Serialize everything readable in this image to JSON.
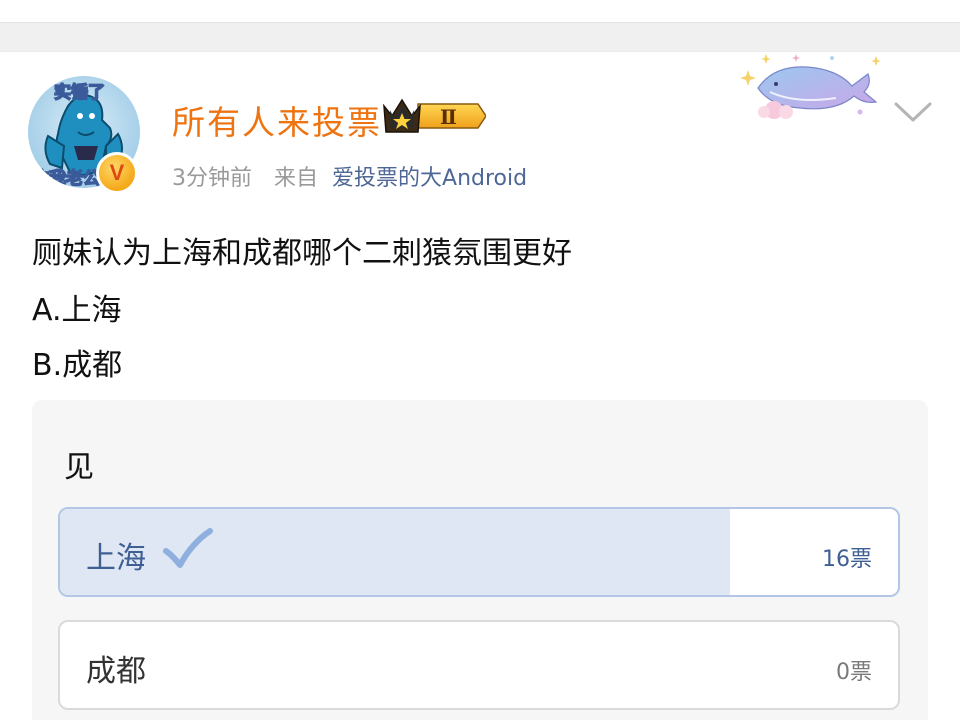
{
  "post": {
    "avatar": {
      "top_text": "实锤了",
      "bottom_text": "这我老公",
      "badge": "V"
    },
    "username": "所有人来投票",
    "level_badge": "Ⅱ",
    "time_ago": "3分钟前",
    "from_label": "来自",
    "source": "爱投票的大Android",
    "content": {
      "line1": "厕妹认为上海和成都哪个二刺猿氛围更好",
      "line2": "A.上海",
      "line3": "B.成都"
    }
  },
  "poll": {
    "title": "见",
    "options": [
      {
        "label": "上海",
        "count": "16票",
        "selected": true,
        "share": 0.8
      },
      {
        "label": "成都",
        "count": "0票",
        "selected": false,
        "share": 0
      }
    ]
  },
  "colors": {
    "username": "#ee7412",
    "source_link": "#4e6796",
    "selected_fill": "#dfe7f4",
    "selected_border": "#b3c6e6",
    "selected_text": "#3f5f93",
    "poll_bg": "#f6f6f6"
  },
  "icons": {
    "crown": "crown-level-icon",
    "decoration": "whale-decoration-icon",
    "menu": "chevron-down-icon",
    "check": "check-icon"
  }
}
